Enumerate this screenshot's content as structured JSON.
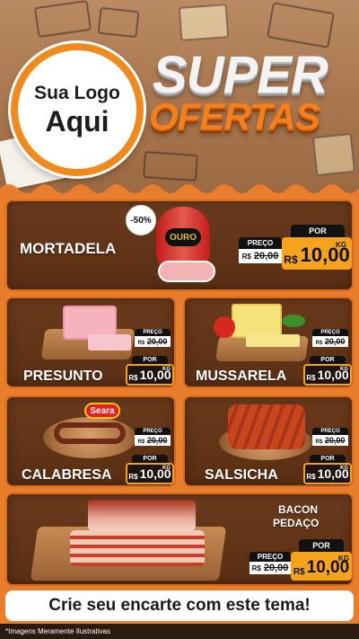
{
  "header": {
    "logo_line1": "Sua Logo",
    "logo_line2": "Aqui",
    "title_top": "SUPER",
    "title_bottom": "OFERTAS"
  },
  "products": {
    "mortadela": {
      "name": "MORTADELA",
      "discount": "-50%",
      "brand": "OURO",
      "old_label": "PREÇO",
      "old_currency": "R$",
      "old_value": "20,00",
      "new_label": "POR",
      "new_currency": "R$",
      "new_value": "10,00",
      "unit": "KG"
    },
    "presunto": {
      "name": "PRESUNTO",
      "old_label": "PREÇO",
      "old_currency": "R$",
      "old_value": "20,00",
      "new_label": "POR",
      "new_currency": "R$",
      "new_value": "10,00",
      "unit": "KG"
    },
    "mussarela": {
      "name": "MUSSARELA",
      "old_label": "PREÇO",
      "old_currency": "R$",
      "old_value": "20,00",
      "new_label": "POR",
      "new_currency": "R$",
      "new_value": "10,00",
      "unit": "KG"
    },
    "calabresa": {
      "name": "CALABRESA",
      "brand": "Seara",
      "old_label": "PREÇO",
      "old_currency": "R$",
      "old_value": "20,00",
      "new_label": "POR",
      "new_currency": "R$",
      "new_value": "10,00",
      "unit": "KG"
    },
    "salsicha": {
      "name": "SALSICHA",
      "old_label": "PREÇO",
      "old_currency": "R$",
      "old_value": "20,00",
      "new_label": "POR",
      "new_currency": "R$",
      "new_value": "10,00",
      "unit": "KG"
    },
    "bacon": {
      "name_line1": "BACON",
      "name_line2": "PEDAÇO",
      "old_label": "PREÇO",
      "old_currency": "R$",
      "old_value": "20,00",
      "new_label": "POR",
      "new_currency": "R$",
      "new_value": "10,00",
      "unit": "KG"
    }
  },
  "footer": {
    "cta": "Crie seu encarte com este tema!",
    "disclaimer": "*Imagens Meramente Ilustrativas"
  },
  "colors": {
    "accent_orange": "#f08a1c",
    "card_brown": "#5a2f14",
    "price_yellow": "#f5a21c"
  }
}
